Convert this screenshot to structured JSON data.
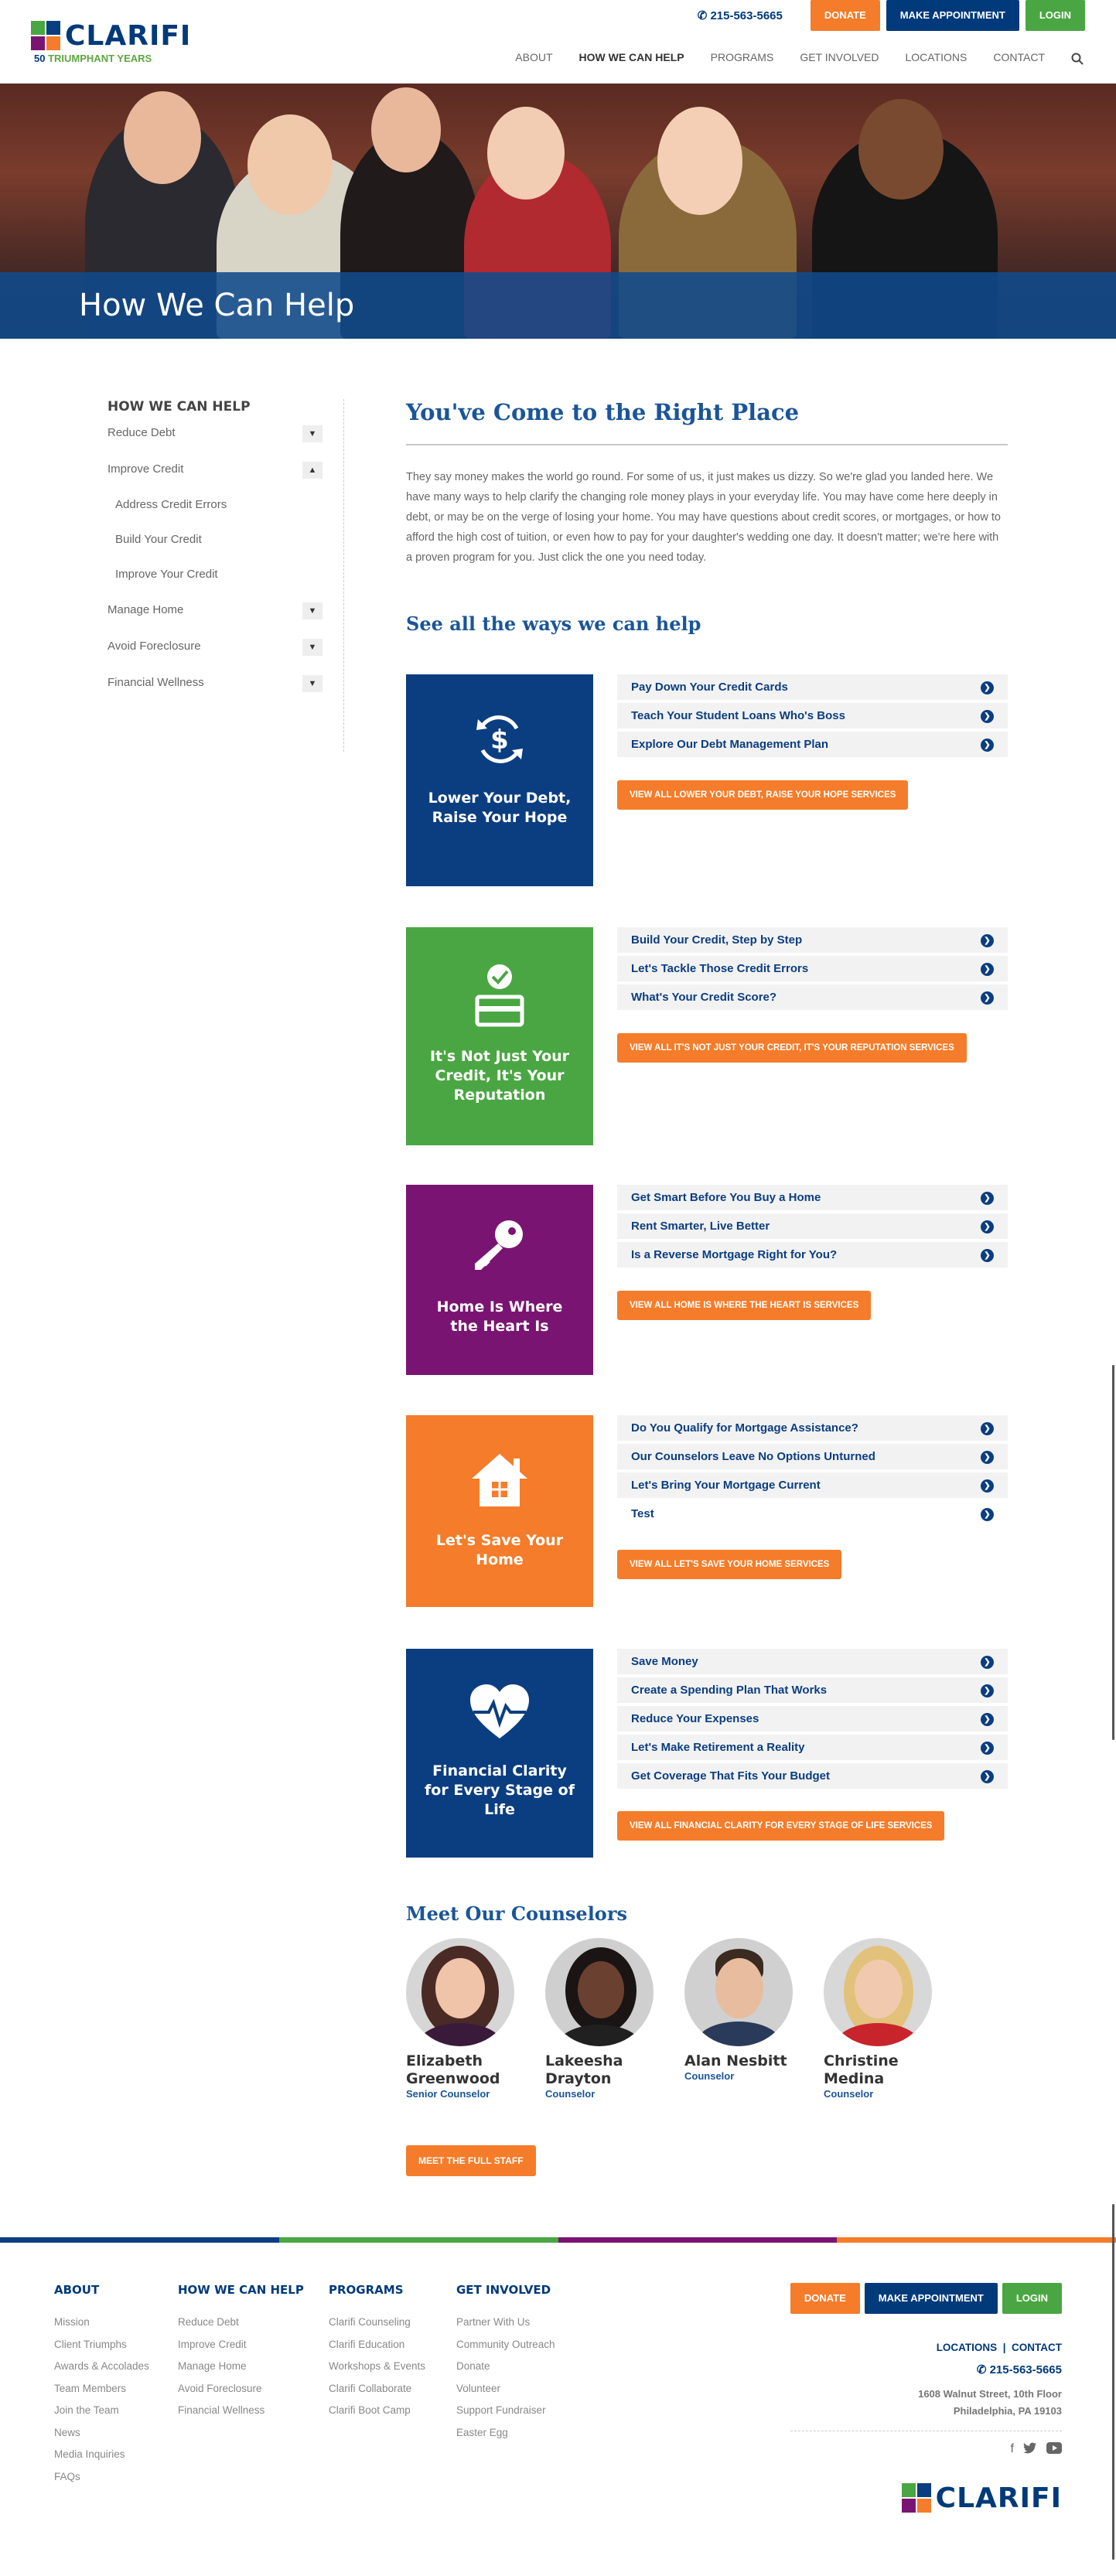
{
  "header": {
    "logo_text": "CLARIFI",
    "logo_sub_num": "50",
    "logo_sub_text": "TRIUMPHANT YEARS",
    "phone": "215-563-5665",
    "donate": "DONATE",
    "appointment": "MAKE APPOINTMENT",
    "login": "LOGIN",
    "nav": [
      "ABOUT",
      "HOW WE CAN HELP",
      "PROGRAMS",
      "GET INVOLVED",
      "LOCATIONS",
      "CONTACT"
    ],
    "active_nav": "HOW WE CAN HELP"
  },
  "hero": {
    "title": "How We Can Help"
  },
  "sidebar": {
    "title": "HOW WE CAN HELP",
    "items": [
      {
        "label": "Reduce Debt",
        "toggle": "▼"
      },
      {
        "label": "Improve Credit",
        "toggle": "▲"
      },
      {
        "label": "Manage Home",
        "toggle": "▼"
      },
      {
        "label": "Avoid Foreclosure",
        "toggle": "▼"
      },
      {
        "label": "Financial Wellness",
        "toggle": "▼"
      }
    ],
    "subitems": [
      "Address Credit Errors",
      "Build Your Credit",
      "Improve Your Credit"
    ]
  },
  "main": {
    "title": "You've Come to the Right Place",
    "intro": "They say money makes the world go round. For some of us, it just makes us dizzy. So we're glad you landed here. We have many ways to help clarify the changing role money plays in your everyday life. You may have come here deeply in debt, or may be on the verge of losing your home. You may have questions about credit scores, or mortgages, or how to afford the high cost of tuition, or even how to pay for your daughter's wedding one day. It doesn't matter; we're here with a proven program for you. Just click the one you need today.",
    "ways_title": "See all the ways we can help"
  },
  "services": [
    {
      "card": "Lower Your Debt, Raise Your Hope",
      "color": "#0b3e80",
      "icon": "dollar-cycle-icon",
      "links": [
        "Pay Down Your Credit Cards",
        "Teach Your Student Loans Who's Boss",
        "Explore Our Debt Management Plan"
      ],
      "view": "VIEW ALL LOWER YOUR DEBT, RAISE YOUR HOPE SERVICES"
    },
    {
      "card": "It's Not Just Your Credit, It's Your Reputation",
      "color": "#4aa642",
      "icon": "credit-check-icon",
      "links": [
        "Build Your Credit, Step by Step",
        "Let's Tackle Those Credit Errors",
        "What's Your Credit Score?"
      ],
      "view": "VIEW ALL IT'S NOT JUST YOUR CREDIT, IT'S YOUR REPUTATION SERVICES"
    },
    {
      "card": "Home Is Where the Heart Is",
      "color": "#7a1472",
      "icon": "key-icon",
      "links": [
        "Get Smart Before You Buy a Home",
        "Rent Smarter, Live Better",
        "Is a Reverse Mortgage Right for You?"
      ],
      "view": "VIEW ALL HOME IS WHERE THE HEART IS SERVICES"
    },
    {
      "card": "Let's Save Your Home",
      "color": "#f47c2a",
      "icon": "house-icon",
      "links": [
        "Do You Qualify for Mortgage Assistance?",
        "Our Counselors Leave No Options Unturned",
        "Let's Bring Your Mortgage Current",
        "Test"
      ],
      "view": "VIEW ALL LET'S SAVE YOUR HOME SERVICES"
    },
    {
      "card": "Financial Clarity for Every Stage of Life",
      "color": "#0b3e80",
      "icon": "heartbeat-icon",
      "links": [
        "Save Money",
        "Create a Spending Plan That Works",
        "Reduce Your Expenses",
        "Let's Make Retirement a Reality",
        "Get Coverage That Fits Your Budget"
      ],
      "view": "VIEW ALL FINANCIAL CLARITY FOR EVERY STAGE OF LIFE SERVICES"
    }
  ],
  "counselors": {
    "title": "Meet Our Counselors",
    "people": [
      {
        "first": "Elizabeth",
        "last": "Greenwood",
        "role": "Senior Counselor"
      },
      {
        "first": "Lakeesha",
        "last": "Drayton",
        "role": "Counselor"
      },
      {
        "first": "Alan Nesbitt",
        "last": "",
        "role": "Counselor"
      },
      {
        "first": "Christine",
        "last": "Medina",
        "role": "Counselor"
      }
    ],
    "staff_button": "MEET THE FULL STAFF"
  },
  "footer": {
    "columns": [
      {
        "title": "ABOUT",
        "items": [
          "Mission",
          "Client Triumphs",
          "Awards & Accolades",
          "Team Members",
          "Join the Team",
          "News",
          "Media Inquiries",
          "FAQs"
        ]
      },
      {
        "title": "HOW WE CAN HELP",
        "items": [
          "Reduce Debt",
          "Improve Credit",
          "Manage Home",
          "Avoid Foreclosure",
          "Financial Wellness"
        ]
      },
      {
        "title": "PROGRAMS",
        "items": [
          "Clarifi Counseling",
          "Clarifi Education",
          "Workshops & Events",
          "Clarifi Collaborate",
          "Clarifi Boot Camp"
        ]
      },
      {
        "title": "GET INVOLVED",
        "items": [
          "Partner With Us",
          "Community Outreach",
          "Donate",
          "Volunteer",
          "Support Fundraiser",
          "Easter Egg"
        ]
      }
    ],
    "donate": "DONATE",
    "appointment": "MAKE APPOINTMENT",
    "login": "LOGIN",
    "locations": "LOCATIONS",
    "sep": "|",
    "contact": "CONTACT",
    "phone": "215-563-5665",
    "address1": "1608 Walnut Street, 10th Floor",
    "address2": "Philadelphia, PA 19103",
    "logo_text": "CLARIFI",
    "social": [
      "facebook-icon",
      "twitter-icon",
      "youtube-icon"
    ]
  },
  "colors": {
    "navy": "#003a7a",
    "green": "#4aa642",
    "purple": "#7a1472",
    "orange": "#f47c2a"
  }
}
